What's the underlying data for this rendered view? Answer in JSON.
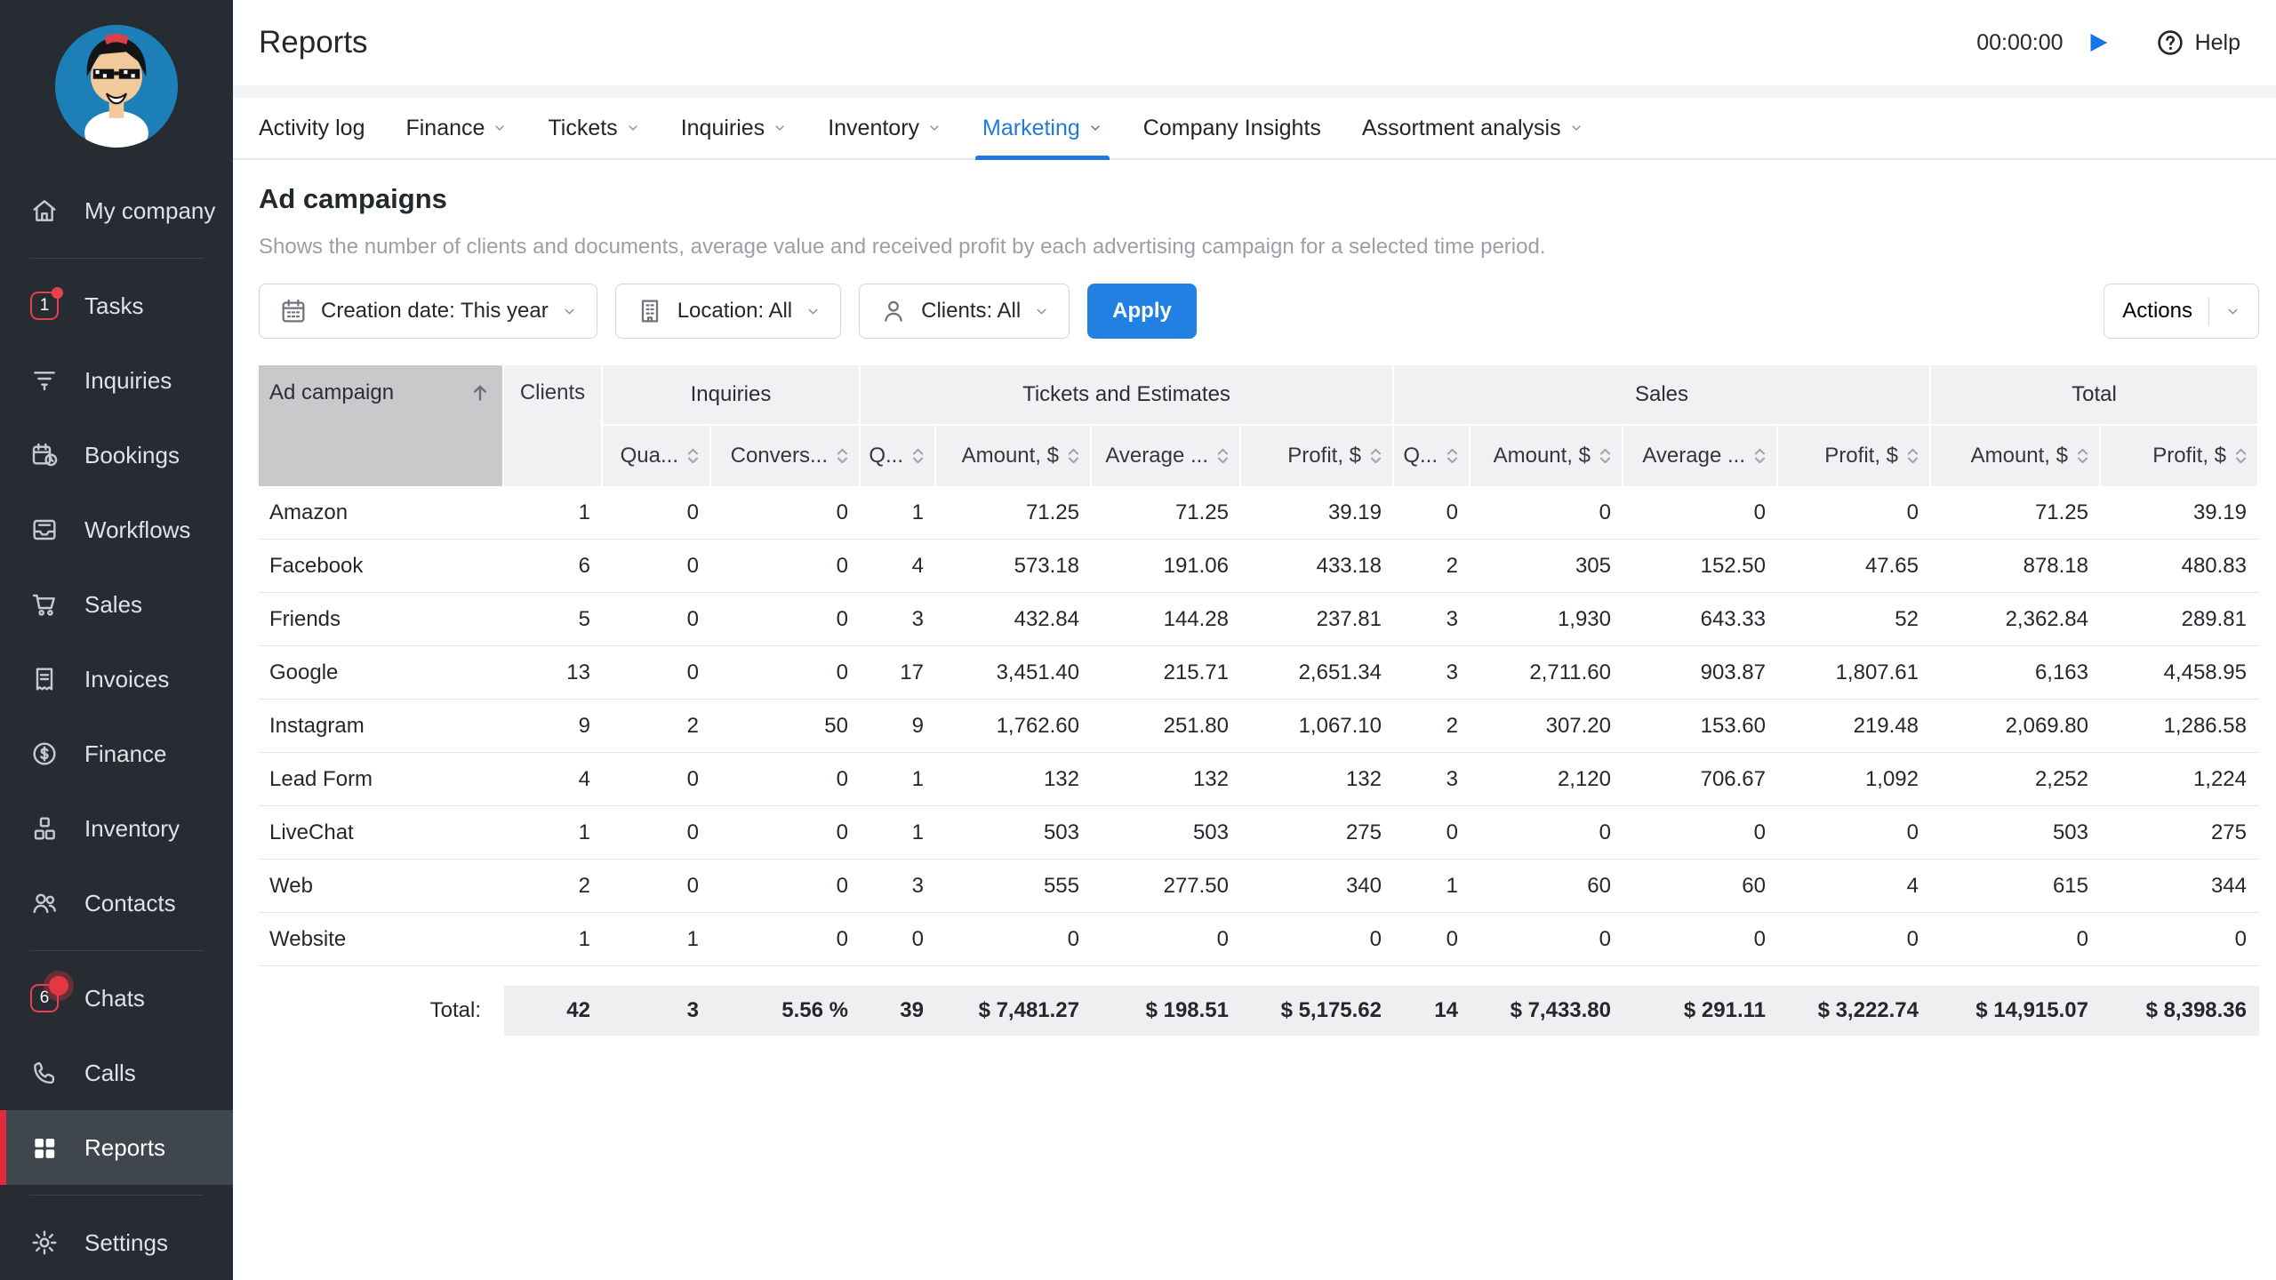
{
  "app": {
    "title": "Reports",
    "timer": "00:00:00",
    "help_label": "Help"
  },
  "colors": {
    "accent_blue": "#2280e3",
    "accent_red": "#e8414e",
    "sidebar_bg": "#272c32",
    "sidebar_active_bg": "#40464d",
    "header_gray": "#f1f0f2",
    "sorted_column_gray": "#c9c9cb",
    "total_row_gray": "#efeef0"
  },
  "sidebar": {
    "items": [
      {
        "label": "My company",
        "icon": "home-icon"
      },
      {
        "label": "Tasks",
        "icon": "tasks-badge-icon",
        "badge": "1"
      },
      {
        "label": "Inquiries",
        "icon": "funnel-icon"
      },
      {
        "label": "Bookings",
        "icon": "calendar-clock-icon"
      },
      {
        "label": "Workflows",
        "icon": "document-tray-icon"
      },
      {
        "label": "Sales",
        "icon": "cart-icon"
      },
      {
        "label": "Invoices",
        "icon": "receipt-icon"
      },
      {
        "label": "Finance",
        "icon": "dollar-circle-icon"
      },
      {
        "label": "Inventory",
        "icon": "cubes-icon"
      },
      {
        "label": "Contacts",
        "icon": "people-icon"
      },
      {
        "label": "Chats",
        "icon": "chats-badge-icon",
        "badge": "6"
      },
      {
        "label": "Calls",
        "icon": "phone-icon"
      },
      {
        "label": "Reports",
        "icon": "grid-icon",
        "active": true
      },
      {
        "label": "Settings",
        "icon": "gear-icon"
      }
    ]
  },
  "tabs": [
    {
      "label": "Activity log",
      "chevron": false
    },
    {
      "label": "Finance",
      "chevron": true
    },
    {
      "label": "Tickets",
      "chevron": true
    },
    {
      "label": "Inquiries",
      "chevron": true
    },
    {
      "label": "Inventory",
      "chevron": true
    },
    {
      "label": "Marketing",
      "chevron": true,
      "active": true
    },
    {
      "label": "Company Insights",
      "chevron": false
    },
    {
      "label": "Assortment analysis",
      "chevron": true
    }
  ],
  "report": {
    "title": "Ad campaigns",
    "description": "Shows the number of clients and documents, average value and received profit by each advertising campaign for a selected time period."
  },
  "filters": {
    "creation_date": "Creation date: This year",
    "location": "Location: All",
    "clients": "Clients: All",
    "apply_label": "Apply",
    "actions_label": "Actions"
  },
  "table": {
    "col_campaign": "Ad campaign",
    "col_clients": "Clients",
    "groups": [
      "Inquiries",
      "Tickets and Estimates",
      "Sales",
      "Total"
    ],
    "subheaders": [
      "Qua...",
      "Convers...",
      "Q...",
      "Amount, $",
      "Average ...",
      "Profit, $",
      "Q...",
      "Amount, $",
      "Average ...",
      "Profit, $",
      "Amount, $",
      "Profit, $"
    ],
    "rows": [
      {
        "campaign": "Amazon",
        "values": [
          "1",
          "0",
          "0",
          "1",
          "71.25",
          "71.25",
          "39.19",
          "0",
          "0",
          "0",
          "0",
          "71.25",
          "39.19"
        ]
      },
      {
        "campaign": "Facebook",
        "values": [
          "6",
          "0",
          "0",
          "4",
          "573.18",
          "191.06",
          "433.18",
          "2",
          "305",
          "152.50",
          "47.65",
          "878.18",
          "480.83"
        ]
      },
      {
        "campaign": "Friends",
        "values": [
          "5",
          "0",
          "0",
          "3",
          "432.84",
          "144.28",
          "237.81",
          "3",
          "1,930",
          "643.33",
          "52",
          "2,362.84",
          "289.81"
        ]
      },
      {
        "campaign": "Google",
        "values": [
          "13",
          "0",
          "0",
          "17",
          "3,451.40",
          "215.71",
          "2,651.34",
          "3",
          "2,711.60",
          "903.87",
          "1,807.61",
          "6,163",
          "4,458.95"
        ]
      },
      {
        "campaign": "Instagram",
        "values": [
          "9",
          "2",
          "50",
          "9",
          "1,762.60",
          "251.80",
          "1,067.10",
          "2",
          "307.20",
          "153.60",
          "219.48",
          "2,069.80",
          "1,286.58"
        ]
      },
      {
        "campaign": "Lead Form",
        "values": [
          "4",
          "0",
          "0",
          "1",
          "132",
          "132",
          "132",
          "3",
          "2,120",
          "706.67",
          "1,092",
          "2,252",
          "1,224"
        ]
      },
      {
        "campaign": "LiveChat",
        "values": [
          "1",
          "0",
          "0",
          "1",
          "503",
          "503",
          "275",
          "0",
          "0",
          "0",
          "0",
          "503",
          "275"
        ]
      },
      {
        "campaign": "Web",
        "values": [
          "2",
          "0",
          "0",
          "3",
          "555",
          "277.50",
          "340",
          "1",
          "60",
          "60",
          "4",
          "615",
          "344"
        ]
      },
      {
        "campaign": "Website",
        "values": [
          "1",
          "1",
          "0",
          "0",
          "0",
          "0",
          "0",
          "0",
          "0",
          "0",
          "0",
          "0",
          "0"
        ]
      }
    ],
    "total": {
      "label": "Total:",
      "values": [
        "42",
        "3",
        "5.56 %",
        "39",
        "$ 7,481.27",
        "$ 198.51",
        "$ 5,175.62",
        "14",
        "$ 7,433.80",
        "$ 291.11",
        "$ 3,222.74",
        "$ 14,915.07",
        "$ 8,398.36"
      ]
    }
  }
}
